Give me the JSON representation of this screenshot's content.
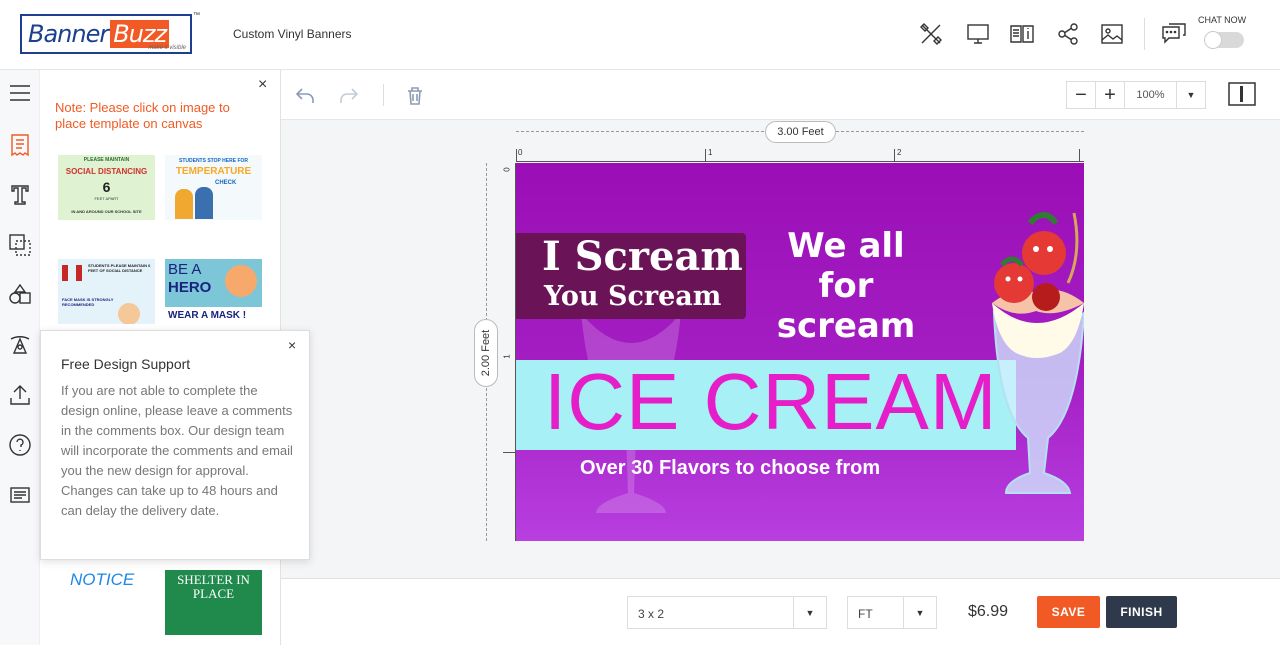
{
  "header": {
    "logo_part1": "Banner",
    "logo_part2": "Buzz",
    "logo_tagline": "make it visible",
    "logo_tm": "™",
    "product_title": "Custom Vinyl Banners",
    "chat_label": "CHAT NOW",
    "icons": [
      "design-tools-icon",
      "preview-icon",
      "product-info-icon",
      "share-icon",
      "image-icon",
      "chat-icon"
    ]
  },
  "panel": {
    "close": "×",
    "note": "Note: Please click on image to place template on canvas",
    "templates": [
      {
        "line1": "PLEASE MAINTAIN",
        "line2": "SOCIAL DISTANCING",
        "line3": "6",
        "line4": "FEET APART",
        "line5": "IN AND AROUND OUR SCHOOL SITE"
      },
      {
        "line1": "STUDENTS STOP HERE FOR",
        "line2": "TEMPERATURE",
        "line3": "CHECK"
      },
      {
        "line1": "STUDENTS PLEASE MAINTAIN 6 FEET OF SOCIAL DISTANCE",
        "line2": "FACE MASK IS STRONGLY RECOMMENDED"
      },
      {
        "line1": "BE A",
        "line2": "HERO",
        "line3": "WEAR A MASK !"
      },
      {
        "line1": "NOTICE"
      },
      {
        "line1": "SHELTER IN",
        "line2": "PLACE"
      }
    ]
  },
  "popup": {
    "title": "Free Design Support",
    "close": "×",
    "body": "If you are not able to complete the design online, please leave a comments in the comments box. Our design team will incorporate the comments and email you the new design for approval. Changes can take up to 48 hours and can delay the delivery date."
  },
  "toolbar": {
    "zoom_value": "100%",
    "zoom_minus": "−",
    "zoom_plus": "+",
    "dropdown_arrow": "▼"
  },
  "canvas": {
    "width_label": "3.00 Feet",
    "height_label": "2.00 Feet",
    "ruler_top": [
      "0",
      "1",
      "2"
    ],
    "ruler_left": [
      "0",
      "1"
    ],
    "banner": {
      "line1": "I Scream",
      "line2": "You Scream",
      "slogan": "We all for scream",
      "headline": "ICE CREAM",
      "subline": "Over 30 Flavors to choose from"
    }
  },
  "bottom": {
    "size_value": "3 x 2",
    "unit_value": "FT",
    "price": "$6.99",
    "save_label": "SAVE",
    "finish_label": "FINISH",
    "arrow": "▼"
  }
}
